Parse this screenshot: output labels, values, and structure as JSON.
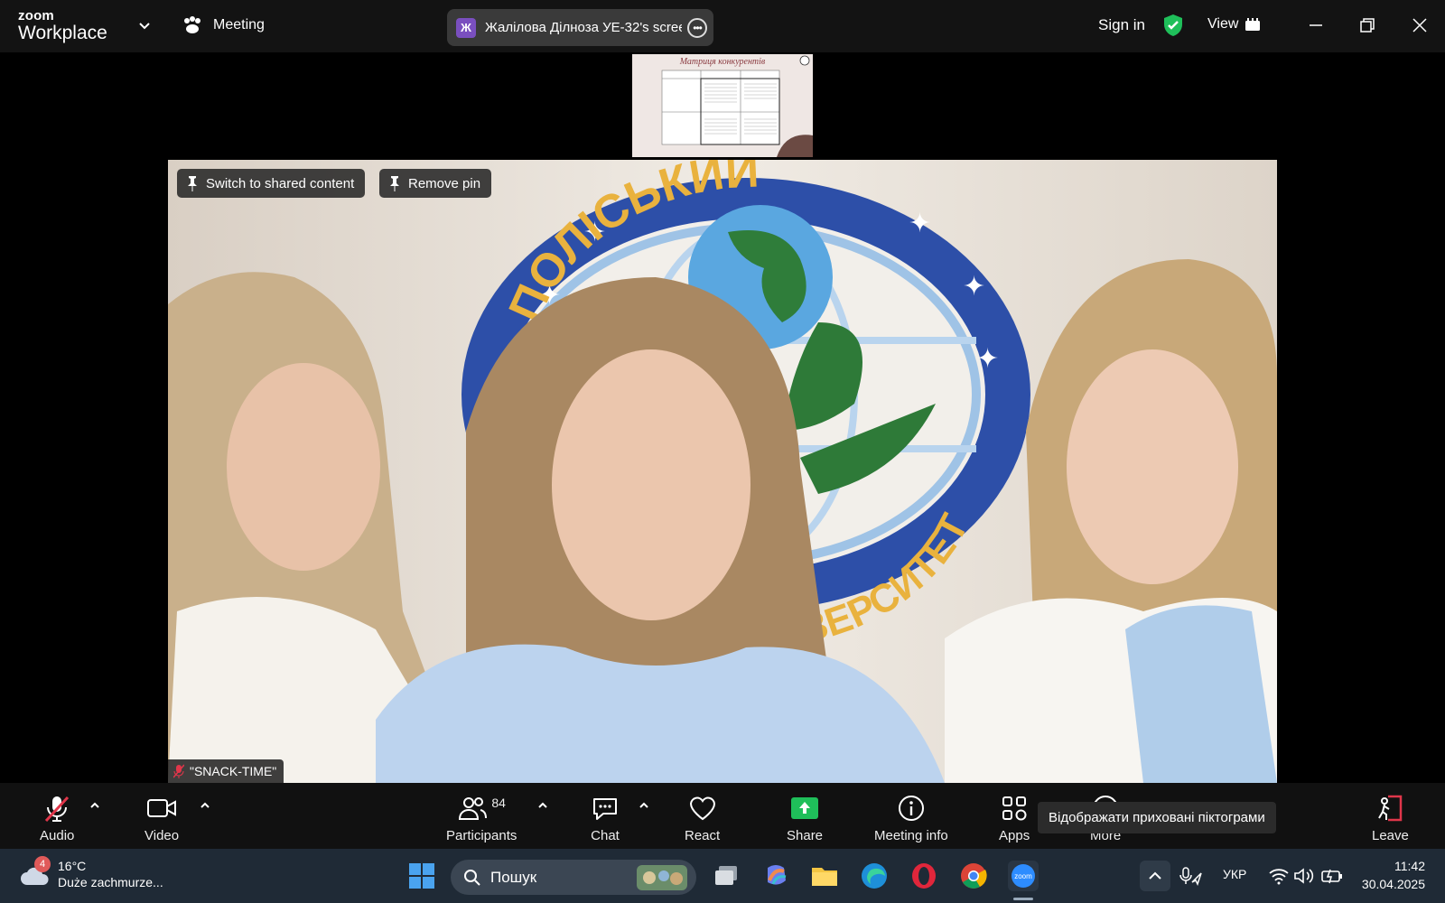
{
  "app": {
    "logo_line1": "zoom",
    "logo_line2": "Workplace",
    "meeting_label": "Meeting",
    "sharer_initial": "Ж",
    "sharer_name": "Жалілова Ділноза  УЕ-32's screen",
    "sign_in": "Sign in",
    "view_label": "View",
    "icons": [
      "chevron-down-icon",
      "meeting-paw-icon",
      "more-dots-icon",
      "shield-check-icon",
      "grid-icon",
      "minimize-icon",
      "restore-icon",
      "close-icon"
    ]
  },
  "thumbnail": {
    "title": "Матриця конкурентів"
  },
  "video": {
    "switch_btn": "Switch to shared content",
    "remove_pin": "Remove pin",
    "participant_name": "\"SNACK-TIME\"",
    "logo_top_text": "ПОЛІСЬКИЙ",
    "logo_bottom_text": "УНІВЕРСИТЕТ"
  },
  "toolbar": {
    "audio": "Audio",
    "video": "Video",
    "participants": "Participants",
    "participants_count": "84",
    "chat": "Chat",
    "react": "React",
    "share": "Share",
    "meeting_info": "Meeting info",
    "apps": "Apps",
    "more": "More",
    "leave": "Leave",
    "tooltip": "Відображати приховані піктограми",
    "share_color": "#1fbf5a",
    "leave_color": "#e0364a"
  },
  "taskbar": {
    "weather_badge": "4",
    "temp": "16°C",
    "weather_desc": "Duże zachmurze...",
    "search_placeholder": "Пошук",
    "lang": "УКР",
    "time": "11:42",
    "date": "30.04.2025"
  }
}
